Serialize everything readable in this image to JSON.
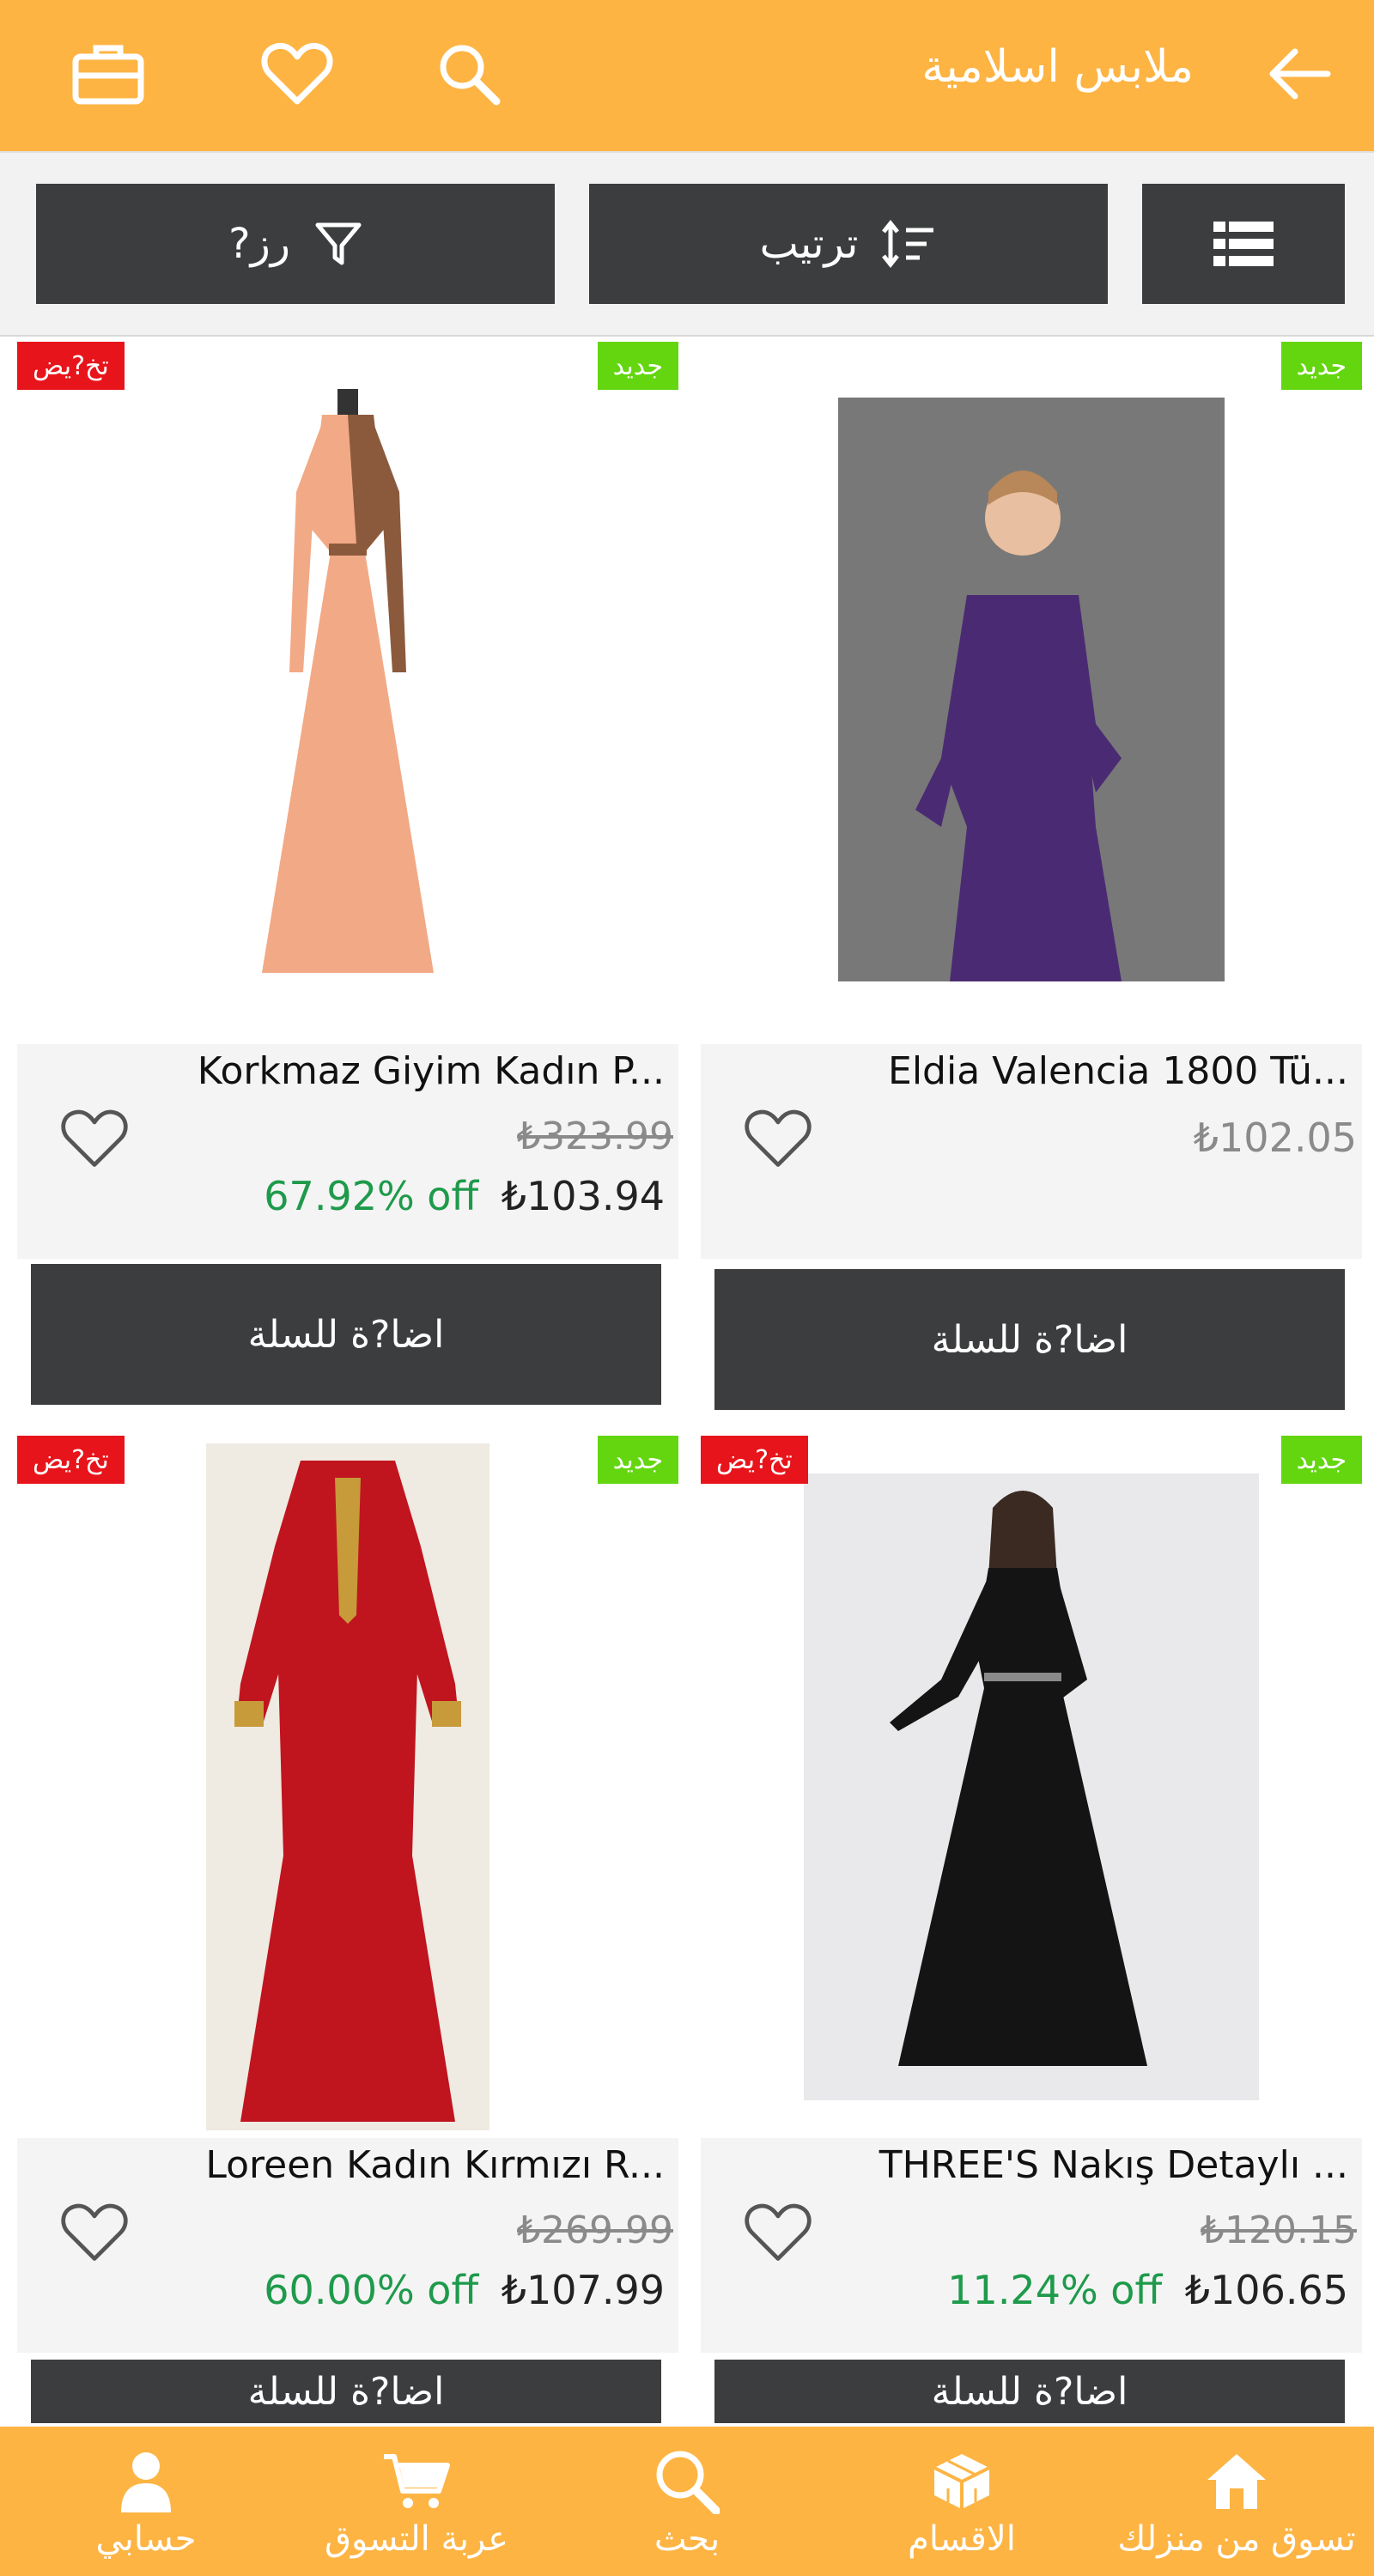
{
  "header": {
    "title": "ملابس اسلامية"
  },
  "toolbar": {
    "filter_label": "?رز",
    "sort_label": "ترتيب"
  },
  "badges": {
    "new": "جديد",
    "sale": "تخ?يض"
  },
  "products": [
    {
      "name": "Korkmaz Giyim Kadın P...",
      "old_price": "₺323.99",
      "price": "₺103.94",
      "discount": "67.92% off",
      "cart_label": "اضا?ة للسلة"
    },
    {
      "name": "Eldia Valencia 1800 Tü...",
      "price": "₺102.05",
      "cart_label": "اضا?ة للسلة"
    },
    {
      "name": "Loreen Kadın Kırmızı R...",
      "old_price": "₺269.99",
      "price": "₺107.99",
      "discount": "60.00% off",
      "cart_label": "اضا?ة للسلة"
    },
    {
      "name": "THREE'S Nakış Detaylı ...",
      "old_price": "₺120.15",
      "price": "₺106.65",
      "discount": "11.24% off",
      "cart_label": "اضا?ة للسلة"
    }
  ],
  "bottom_nav": [
    {
      "label": "تسوق من منزلك",
      "icon": "home-icon"
    },
    {
      "label": "الاقسام",
      "icon": "categories-icon"
    },
    {
      "label": "بحث",
      "icon": "search-icon"
    },
    {
      "label": "عربة التسوق",
      "icon": "cart-icon"
    },
    {
      "label": "حسابي",
      "icon": "account-icon"
    }
  ],
  "colors": {
    "accent": "#FDB443",
    "dark_button": "#3b3d3e",
    "badge_new": "#63D60F",
    "badge_sale": "#E8141B",
    "discount_text": "#1e9a4b"
  }
}
